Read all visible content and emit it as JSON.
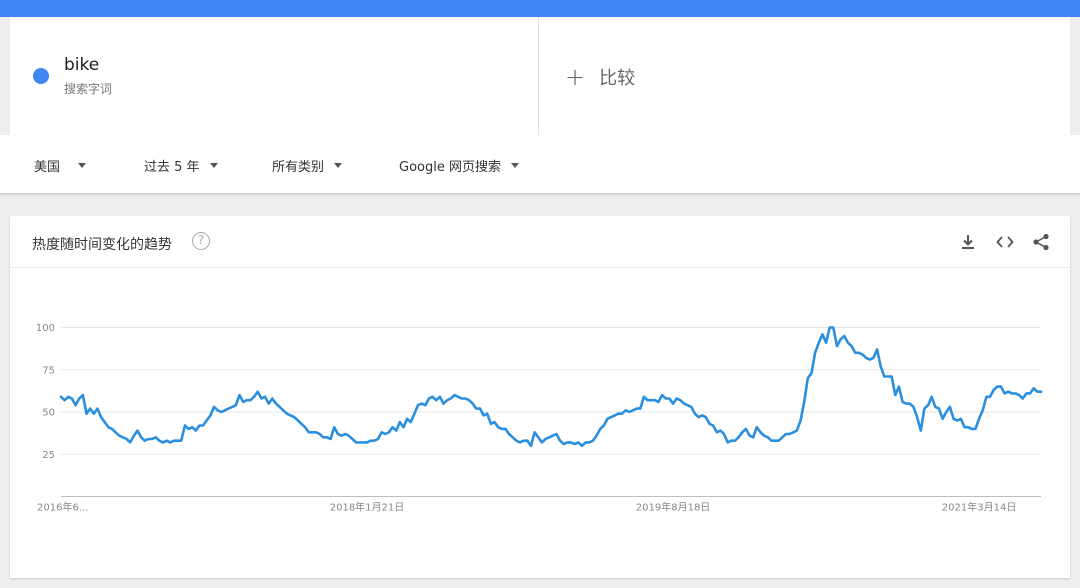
{
  "term": {
    "name": "bike",
    "subtitle": "搜索字词",
    "color": "#4285f4"
  },
  "compare": {
    "label": "比较"
  },
  "filters": [
    {
      "label": "美国"
    },
    {
      "label": "过去 5 年"
    },
    {
      "label": "所有类别"
    },
    {
      "label": "Google 网页搜索"
    }
  ],
  "card": {
    "title": "热度随时间变化的趋势",
    "help_icon": "help-icon",
    "tools": [
      "download-icon",
      "embed-icon",
      "share-icon"
    ]
  },
  "chart_data": {
    "type": "line",
    "title": "",
    "ylim": [
      0,
      100
    ],
    "yticks": [
      25,
      50,
      75,
      100
    ],
    "grid": true,
    "x_tick_labels": [
      "2016年6...",
      "2018年1月21日",
      "2019年8月18日",
      "2021年3月14日"
    ],
    "x_tick_index": [
      0,
      84,
      168,
      252
    ],
    "series": [
      {
        "color": "#2b8fe0",
        "values": [
          59,
          57,
          59,
          58,
          54,
          58,
          60,
          49,
          52,
          49,
          52,
          47,
          44,
          41,
          40,
          38,
          36,
          35,
          34,
          32,
          36,
          39,
          35,
          33,
          34,
          34,
          35,
          33,
          32,
          33,
          32,
          33,
          33,
          33,
          42,
          40,
          41,
          39,
          42,
          42,
          45,
          48,
          53,
          51,
          50,
          51,
          52,
          53,
          54,
          60,
          56,
          57,
          57,
          59,
          62,
          58,
          59,
          55,
          58,
          55,
          53,
          51,
          49,
          48,
          47,
          45,
          43,
          41,
          38,
          38,
          38,
          37,
          35,
          35,
          34,
          41,
          37,
          36,
          37,
          36,
          34,
          32,
          32,
          32,
          32,
          33,
          33,
          34,
          38,
          37,
          38,
          41,
          39,
          44,
          41,
          46,
          44,
          49,
          54,
          55,
          54,
          58,
          59,
          57,
          59,
          55,
          57,
          58,
          60,
          59,
          58,
          58,
          57,
          55,
          52,
          52,
          48,
          49,
          43,
          44,
          41,
          40,
          40,
          37,
          35,
          33,
          32,
          33,
          33,
          30,
          38,
          35,
          32,
          34,
          35,
          36,
          37,
          33,
          31,
          32,
          32,
          31,
          32,
          30,
          32,
          32,
          33,
          36,
          40,
          42,
          46,
          47,
          48,
          49,
          49,
          51,
          50,
          51,
          52,
          52,
          59,
          57,
          57,
          57,
          56,
          60,
          58,
          58,
          55,
          58,
          57,
          55,
          54,
          53,
          49,
          47,
          48,
          47,
          43,
          42,
          38,
          39,
          37,
          32,
          33,
          33,
          35,
          38,
          40,
          36,
          35,
          41,
          38,
          36,
          35,
          33,
          33,
          33,
          35,
          37,
          37,
          38,
          39,
          45,
          56,
          70,
          73,
          85,
          91,
          96,
          91,
          100,
          100,
          89,
          93,
          95,
          91,
          89,
          85,
          85,
          84,
          82,
          81,
          82,
          87,
          77,
          71,
          71,
          71,
          60,
          65,
          56,
          55,
          55,
          53,
          47,
          39,
          52,
          54,
          59,
          53,
          52,
          46,
          50,
          53,
          46,
          45,
          46,
          41,
          41,
          40,
          40,
          46,
          51,
          59,
          59,
          63,
          65,
          65,
          61,
          62,
          61,
          61,
          60,
          58,
          61,
          61,
          64,
          62,
          62
        ]
      }
    ]
  }
}
